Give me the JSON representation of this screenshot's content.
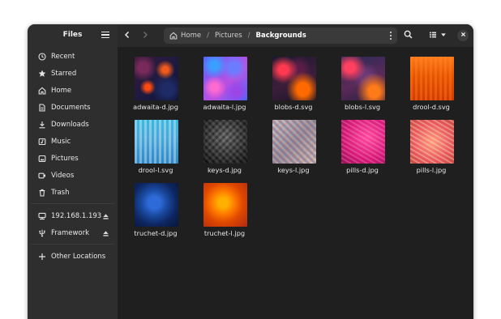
{
  "sidebar": {
    "title": "Files",
    "items": [
      {
        "label": "Recent",
        "icon": "clock-icon"
      },
      {
        "label": "Starred",
        "icon": "star-icon"
      },
      {
        "label": "Home",
        "icon": "home-icon"
      },
      {
        "label": "Documents",
        "icon": "document-icon"
      },
      {
        "label": "Downloads",
        "icon": "download-icon"
      },
      {
        "label": "Music",
        "icon": "music-icon"
      },
      {
        "label": "Pictures",
        "icon": "picture-icon"
      },
      {
        "label": "Videos",
        "icon": "video-icon"
      },
      {
        "label": "Trash",
        "icon": "trash-icon"
      }
    ],
    "devices": [
      {
        "label": "192.168.1.193",
        "icon": "network-drive-icon"
      },
      {
        "label": "Framework",
        "icon": "usb-icon"
      }
    ],
    "other_locations": {
      "label": "Other Locations",
      "icon": "plus-icon"
    }
  },
  "breadcrumb": {
    "items": [
      "Home",
      "Pictures",
      "Backgrounds"
    ],
    "separator": "/"
  },
  "files": [
    {
      "name": "adwaita-d.jpg"
    },
    {
      "name": "adwaita-l.jpg"
    },
    {
      "name": "blobs-d.svg"
    },
    {
      "name": "blobs-l.svg"
    },
    {
      "name": "drool-d.svg"
    },
    {
      "name": "drool-l.svg"
    },
    {
      "name": "keys-d.jpg"
    },
    {
      "name": "keys-l.jpg"
    },
    {
      "name": "pills-d.jpg"
    },
    {
      "name": "pills-l.jpg"
    },
    {
      "name": "truchet-d.jpg"
    },
    {
      "name": "truchet-l.jpg"
    }
  ],
  "colors": {
    "window_bg": "#242424",
    "sidebar_bg": "#2e2e2e",
    "pathbar_bg": "#3a3a3a",
    "text": "#e8e8e8"
  }
}
